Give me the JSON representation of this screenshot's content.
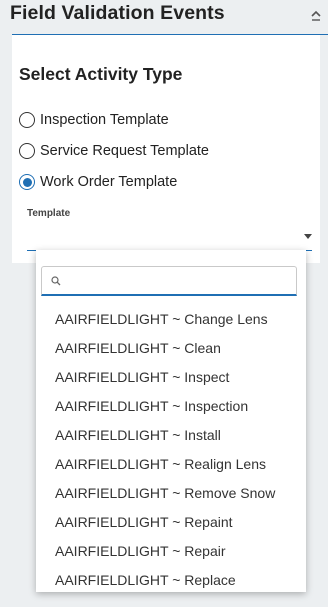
{
  "header": {
    "title": "Field Validation Events"
  },
  "section": {
    "title": "Select Activity Type"
  },
  "activity_types": [
    {
      "label": "Inspection Template",
      "selected": false
    },
    {
      "label": "Service Request Template",
      "selected": false
    },
    {
      "label": "Work Order Template",
      "selected": true
    }
  ],
  "template_field": {
    "label": "Template",
    "value": ""
  },
  "dropdown": {
    "search_value": "",
    "options": [
      "AAIRFIELDLIGHT ~ Change Lens",
      "AAIRFIELDLIGHT ~ Clean",
      "AAIRFIELDLIGHT ~ Inspect",
      "AAIRFIELDLIGHT ~ Inspection",
      "AAIRFIELDLIGHT ~ Install",
      "AAIRFIELDLIGHT ~ Realign Lens",
      "AAIRFIELDLIGHT ~ Remove Snow",
      "AAIRFIELDLIGHT ~ Repaint",
      "AAIRFIELDLIGHT ~ Repair",
      "AAIRFIELDLIGHT ~ Replace"
    ]
  },
  "colors": {
    "accent": "#1f6fb4",
    "background": "#eceff1",
    "panel": "#ffffff"
  },
  "icons": {
    "collapse": "chevron-up-icon",
    "search": "search-icon",
    "select_caret": "caret-down-icon"
  }
}
